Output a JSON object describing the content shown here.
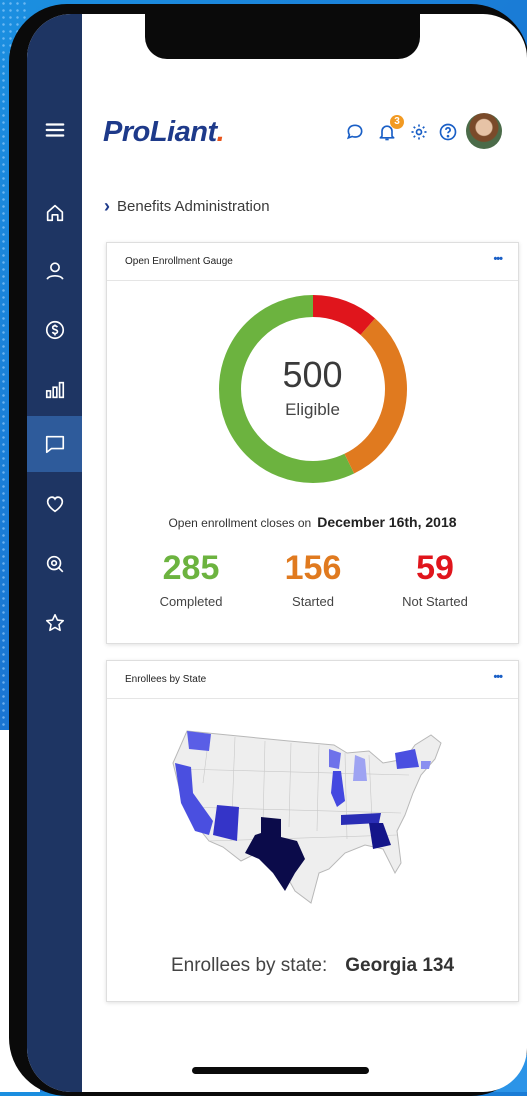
{
  "brand": {
    "logo_text": "ProLiant",
    "logo_dot": "."
  },
  "header": {
    "icons": [
      "chat-icon",
      "bell-icon",
      "gear-icon",
      "help-icon"
    ],
    "notification_count": "3"
  },
  "sidebar": {
    "items": [
      {
        "name": "menu",
        "icon": "hamburger-icon"
      },
      {
        "name": "home",
        "icon": "home-icon"
      },
      {
        "name": "people",
        "icon": "person-icon"
      },
      {
        "name": "payroll",
        "icon": "dollar-icon"
      },
      {
        "name": "reports",
        "icon": "bar-chart-icon"
      },
      {
        "name": "benefits",
        "icon": "message-icon",
        "active": true
      },
      {
        "name": "wellness",
        "icon": "heart-icon"
      },
      {
        "name": "search",
        "icon": "search-icon"
      },
      {
        "name": "favorites",
        "icon": "star-icon"
      }
    ]
  },
  "breadcrumb": {
    "label": "Benefits Administration"
  },
  "gauge_card": {
    "title": "Open Enrollment Gauge",
    "more": "•••",
    "center_value": "500",
    "center_label": "Eligible",
    "closes_prefix": "Open enrollment closes on",
    "closes_date": "December 16th, 2018",
    "stats": [
      {
        "value": "285",
        "label": "Completed",
        "color": "#6cb33f"
      },
      {
        "value": "156",
        "label": "Started",
        "color": "#e07a1f"
      },
      {
        "value": "59",
        "label": "Not Started",
        "color": "#e0151c"
      }
    ]
  },
  "map_card": {
    "title": "Enrollees by State",
    "more": "•••",
    "footer_label": "Enrollees by state:",
    "footer_value": "Georgia 134"
  },
  "colors": {
    "sidebar": "#1e3563",
    "sidebar_active": "#2e5b9b",
    "brand": "#1e3a8a",
    "accent_link": "#1a5fc6"
  }
}
